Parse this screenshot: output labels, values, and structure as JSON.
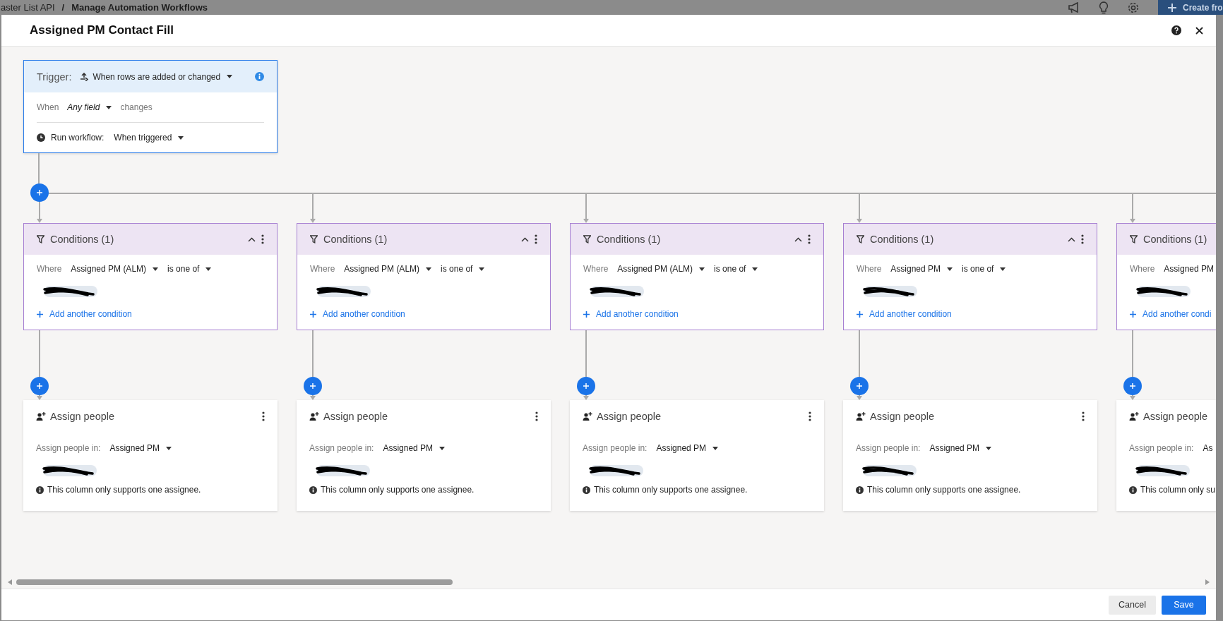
{
  "page_behind": {
    "breadcrumb": [
      {
        "label": "aster List API"
      },
      {
        "label": "Manage Automation Workflows"
      }
    ],
    "separator": "/",
    "create_button": "Create fro"
  },
  "dialog": {
    "title": "Assigned PM Contact Fill"
  },
  "trigger": {
    "label": "Trigger:",
    "type": "When rows are added or changed",
    "when_label": "When",
    "field": "Any field",
    "changes": "changes",
    "run_label": "Run workflow:",
    "run_value": "When triggered"
  },
  "branches": [
    {
      "condition": {
        "title": "Conditions (1)",
        "where": "Where",
        "field": "Assigned PM (ALM)",
        "operator": "is one of",
        "chip": {
          "kind": "redacted"
        },
        "add": "Add another condition"
      },
      "action": {
        "title": "Assign people",
        "in_label": "Assign people in:",
        "column": "Assigned PM",
        "chip": {
          "kind": "redacted"
        },
        "note": "This column only supports one assignee."
      }
    },
    {
      "condition": {
        "title": "Conditions (1)",
        "where": "Where",
        "field": "Assigned PM (ALM)",
        "operator": "is one of",
        "chip": {
          "kind": "redacted"
        },
        "add": "Add another condition"
      },
      "action": {
        "title": "Assign people",
        "in_label": "Assign people in:",
        "column": "Assigned PM",
        "chip": {
          "kind": "redacted"
        },
        "note": "This column only supports one assignee."
      }
    },
    {
      "condition": {
        "title": "Conditions (1)",
        "where": "Where",
        "field": "Assigned PM (ALM)",
        "operator": "is one of",
        "chip": {
          "kind": "redacted"
        },
        "add": "Add another condition"
      },
      "action": {
        "title": "Assign people",
        "in_label": "Assign people in:",
        "column": "Assigned PM",
        "chip": {
          "kind": "redacted"
        },
        "note": "This column only supports one assignee."
      }
    },
    {
      "condition": {
        "title": "Conditions (1)",
        "where": "Where",
        "field": "Assigned PM",
        "operator": "is one of",
        "chip": {
          "kind": "redacted"
        },
        "add": "Add another condition"
      },
      "action": {
        "title": "Assign people",
        "in_label": "Assign people in:",
        "column": "Assigned PM",
        "chip": {
          "kind": "redacted"
        },
        "note": "This column only supports one assignee."
      }
    },
    {
      "condition": {
        "title": "Conditions (1)",
        "where": "Where",
        "field": "Assigned PM",
        "chip": {
          "kind": "redacted"
        },
        "add": "Add another condi"
      },
      "action": {
        "title": "Assign people",
        "in_label": "Assign people in:",
        "column": "As",
        "chip": {
          "kind": "redacted"
        },
        "note": "This column only su"
      }
    }
  ],
  "footer": {
    "cancel": "Cancel",
    "save": "Save"
  }
}
